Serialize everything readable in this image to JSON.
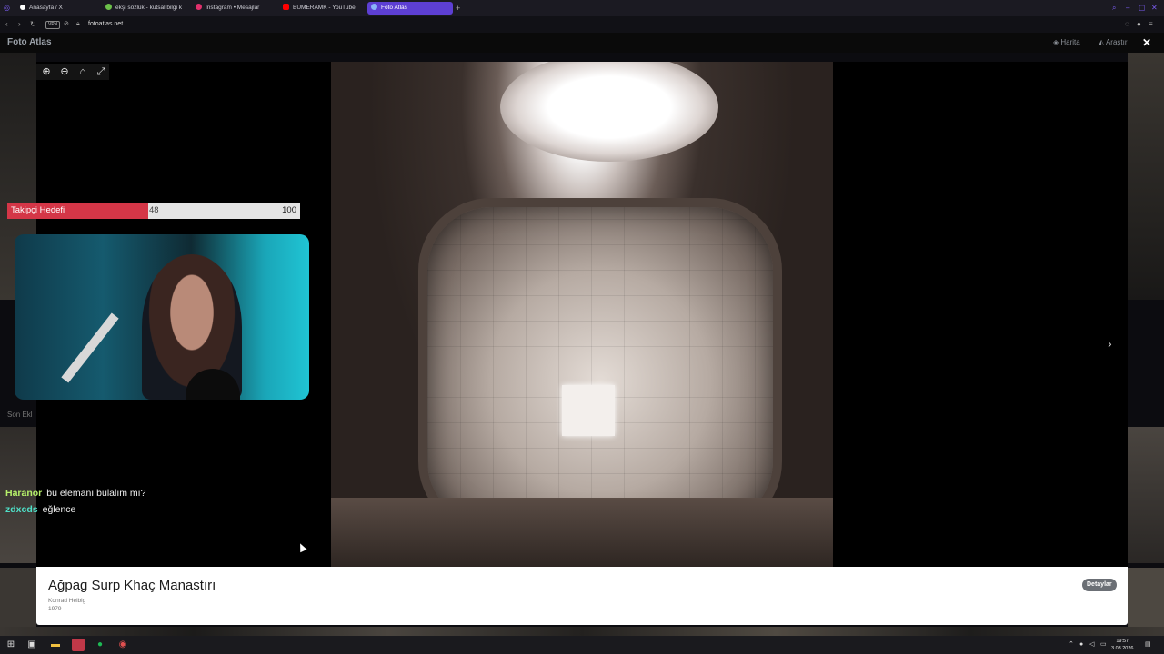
{
  "browser": {
    "tabs": [
      {
        "label": "Anasayfa / X",
        "color": "#ffffff"
      },
      {
        "label": "ekşi sözlük - kutsal bilgi k",
        "color": "#6cc04a"
      },
      {
        "label": "Instagram • Mesajlar",
        "color": "#e1306c"
      },
      {
        "label": "BUMERAMK - YouTube",
        "color": "#ff0000"
      },
      {
        "label": "Foto Atlas",
        "color": "#8ab4f8"
      }
    ],
    "active_tab": 4,
    "vpn": "VPN",
    "url": "fotoatlas.net"
  },
  "site": {
    "title": "Foto Atlas",
    "nav": {
      "map": "Harita",
      "explore": "Araştır"
    },
    "section_recent": "Son Ekl"
  },
  "lightbox": {
    "zoom_tools": [
      "zoom-in",
      "zoom-out",
      "home",
      "fullscreen"
    ],
    "photo_title": "Ağpag Surp Khaç Manastırı",
    "author": "Konrad Helbig",
    "year": "1979",
    "details_button": "Detaylar"
  },
  "stream": {
    "goal_label": "Takipçi Hedefi",
    "goal_current": "48",
    "goal_max": "100",
    "goal_progress": 0.48,
    "chat": [
      {
        "user": "Haranor",
        "message": "bu elemanı bulalım mı?",
        "color": "#b6f06a"
      },
      {
        "user": "zdxcds",
        "message": "eğlence",
        "color": "#4fe0c8"
      }
    ]
  },
  "taskbar": {
    "time": "19:57",
    "date": "3.03.2026"
  }
}
